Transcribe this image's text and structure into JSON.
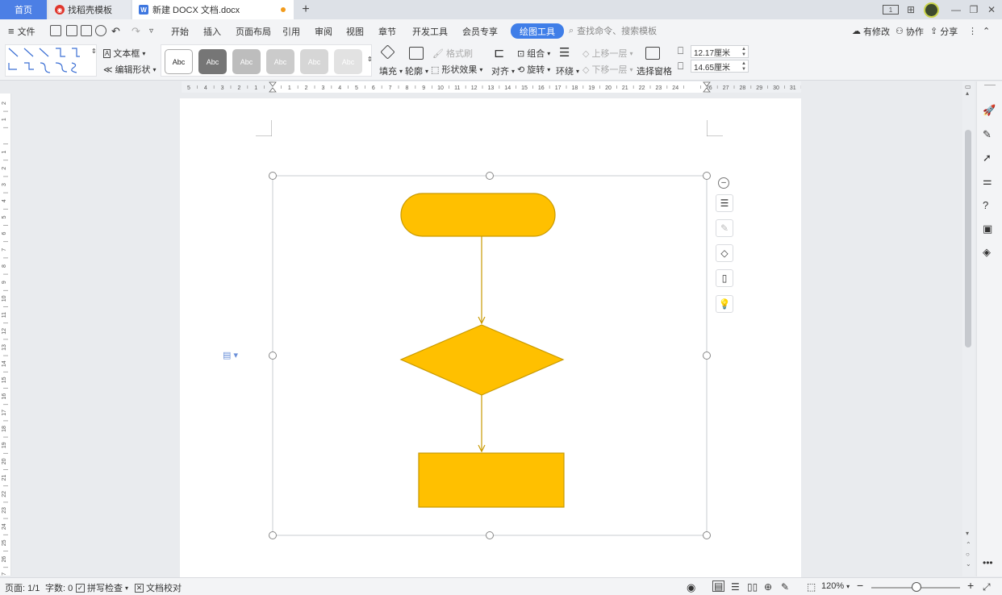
{
  "titlebar": {
    "tabs": [
      {
        "label": "首页"
      },
      {
        "label": "找稻壳模板"
      },
      {
        "label": "新建 DOCX 文档.docx"
      }
    ],
    "new_tab": "+"
  },
  "menubar": {
    "file": "文件",
    "items": [
      "开始",
      "插入",
      "页面布局",
      "引用",
      "审阅",
      "视图",
      "章节",
      "开发工具",
      "会员专享"
    ],
    "active": "绘图工具",
    "search_placeholder": "查找命令、搜索模板",
    "right": [
      "有修改",
      "协作",
      "分享"
    ]
  },
  "ribbon": {
    "textbox": "文本框",
    "edit_shape": "编辑形状",
    "style_label": "Abc",
    "format_painter": "格式刷",
    "fill": "填充",
    "outline": "轮廓",
    "shape_effect": "形状效果",
    "align": "对齐",
    "group": "组合",
    "rotate": "旋转",
    "wrap": "环绕",
    "bring_forward": "上移一层",
    "send_backward": "下移一层",
    "selection_pane": "选择窗格",
    "width": "12.17厘米",
    "height": "14.65厘米"
  },
  "ruler": {
    "top_labels": [
      "5",
      "4",
      "3",
      "2",
      "1",
      "",
      "1",
      "2",
      "3",
      "4",
      "5",
      "6",
      "7",
      "8",
      "9",
      "10",
      "11",
      "12",
      "13",
      "14",
      "15",
      "16",
      "17",
      "18",
      "19",
      "20",
      "21",
      "22",
      "23",
      "24",
      "",
      "26",
      "27",
      "28",
      "29",
      "30",
      "31"
    ],
    "left_labels": [
      "2",
      "1",
      "",
      "1",
      "2",
      "3",
      "4",
      "5",
      "6",
      "7",
      "8",
      "9",
      "10",
      "11",
      "12",
      "13",
      "14",
      "15",
      "16",
      "17",
      "18",
      "19",
      "20",
      "21",
      "22",
      "23",
      "24",
      "25",
      "26",
      "27"
    ]
  },
  "colors": {
    "shape_fill": "#ffc000",
    "shape_stroke": "#c99a00",
    "accent": "#3f7ee8"
  },
  "statusbar": {
    "page": "页面: 1/1",
    "words": "字数: 0",
    "spell": "拼写检查",
    "proof": "文档校对",
    "zoom": "120%"
  }
}
